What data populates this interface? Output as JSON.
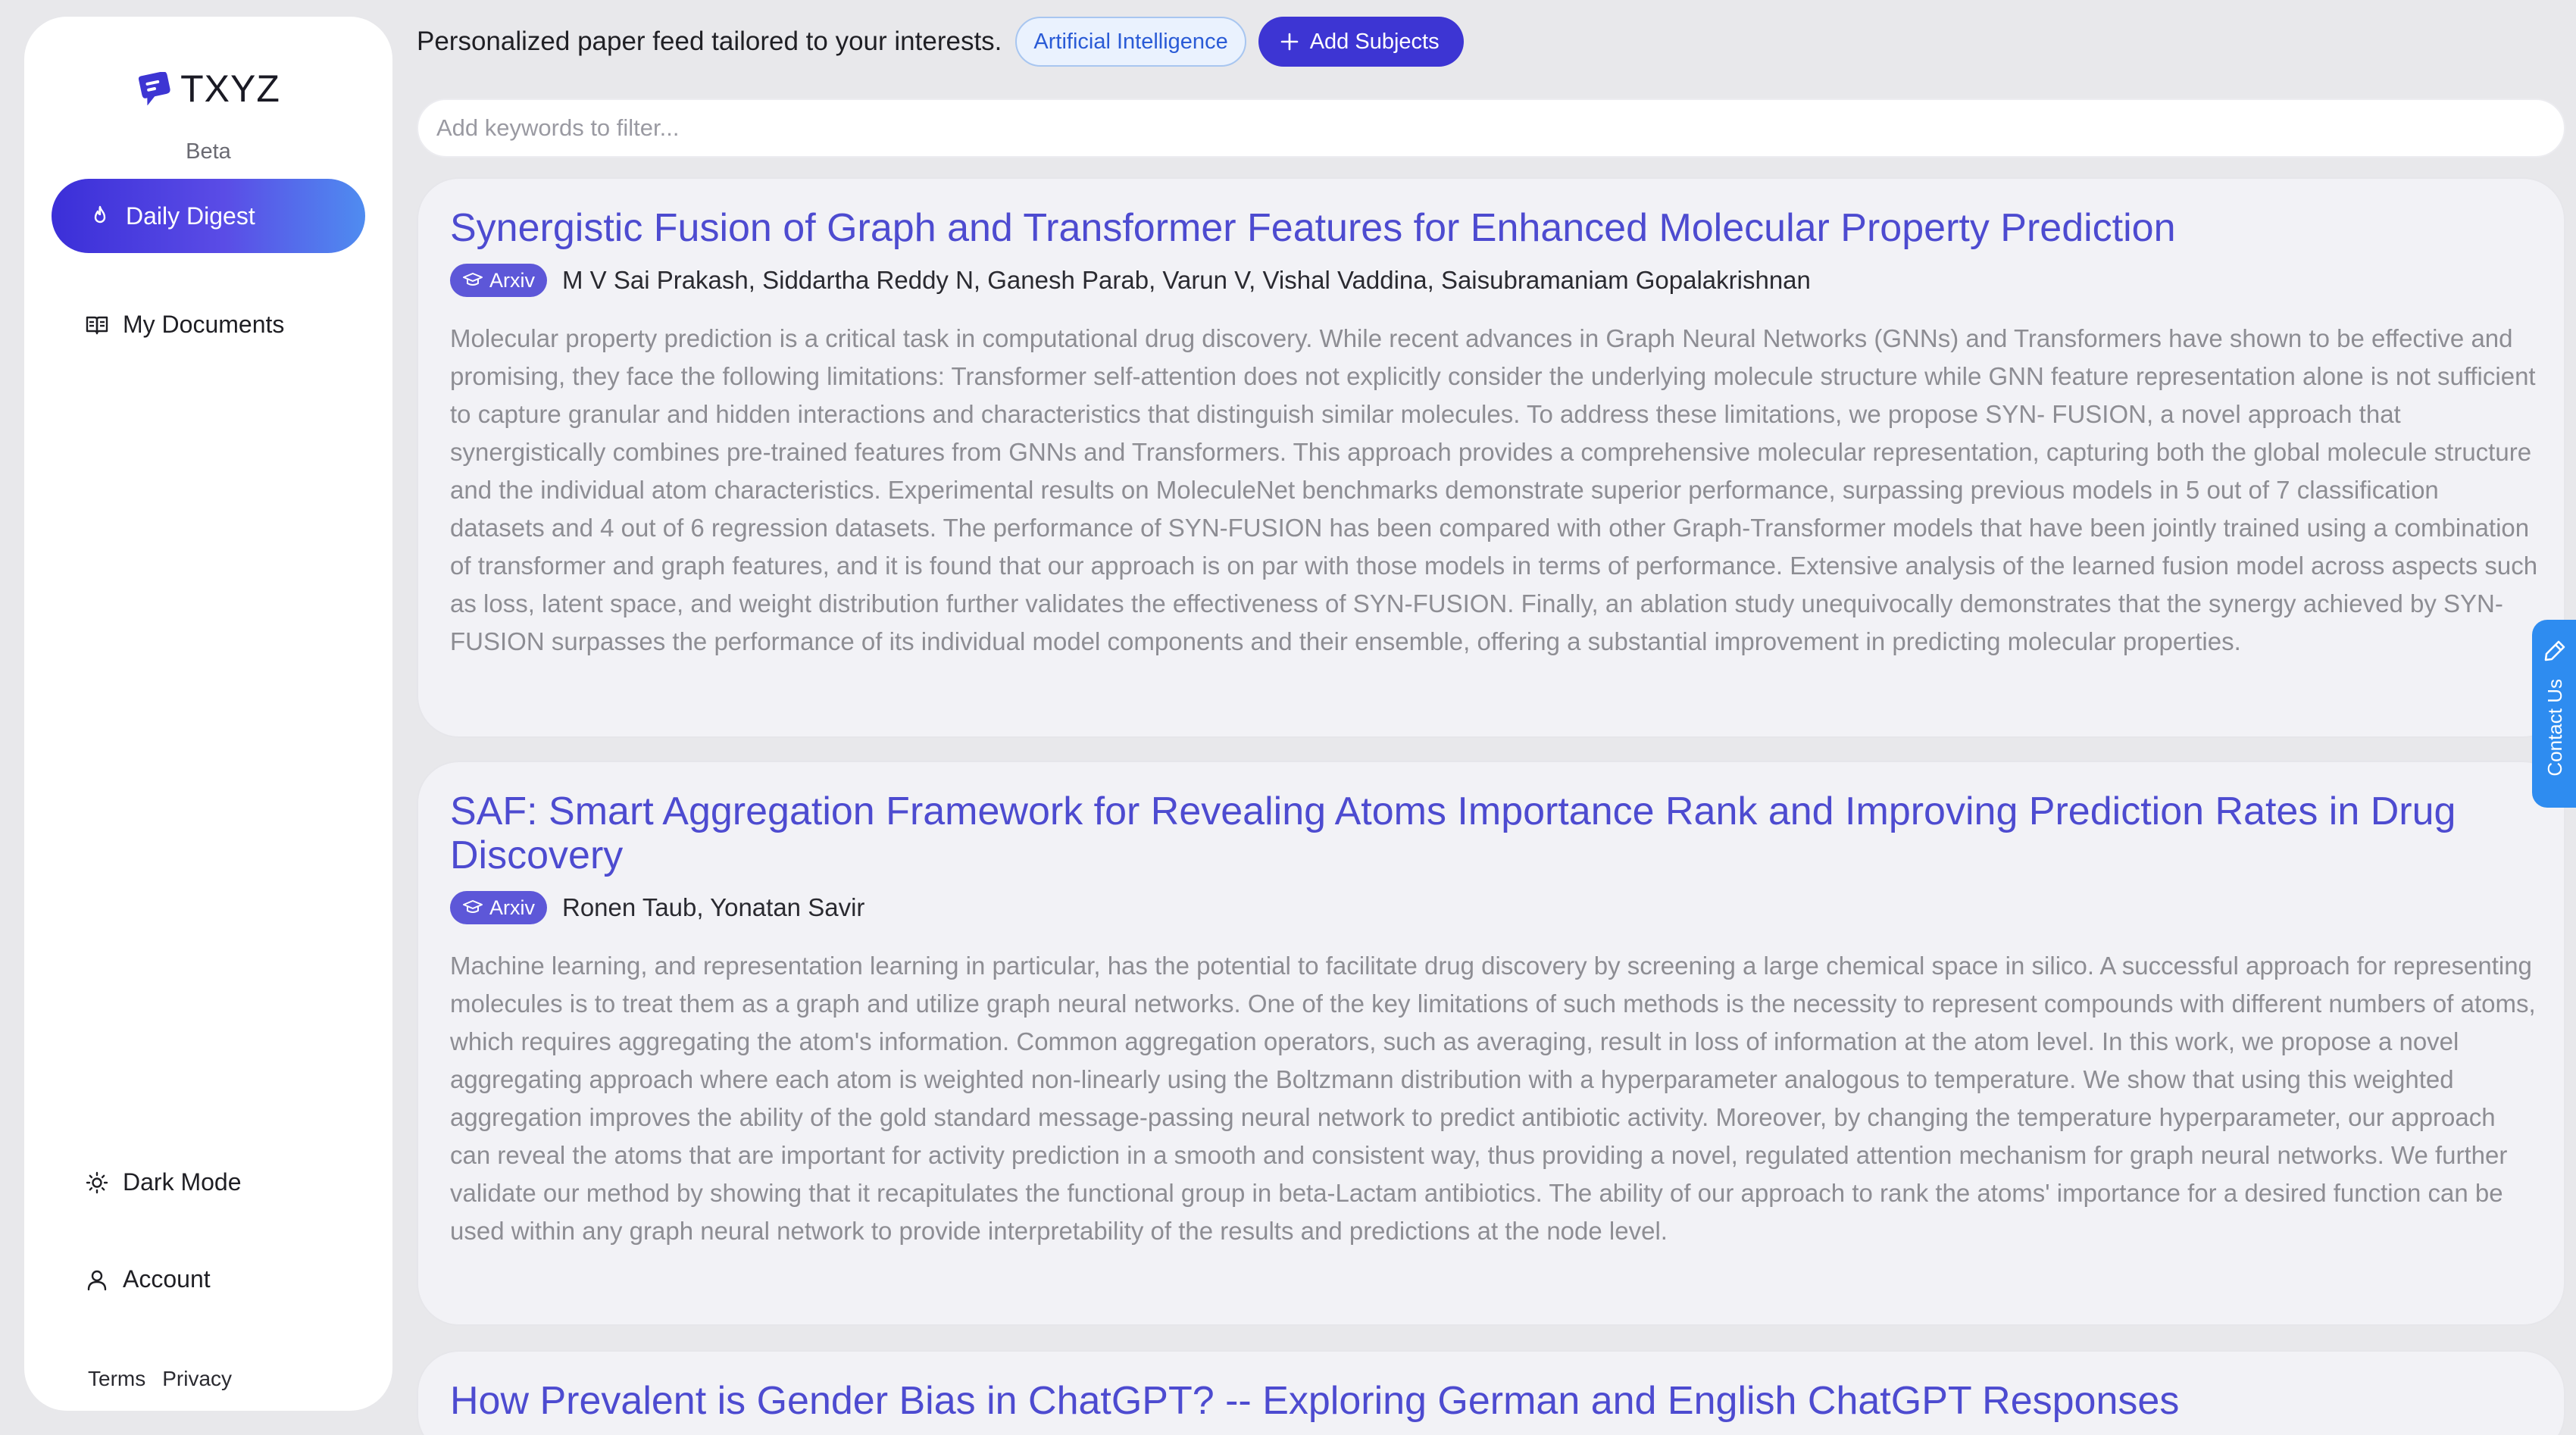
{
  "app": {
    "brand": "TXYZ",
    "badge": "Beta"
  },
  "sidebar": {
    "nav": [
      {
        "label": "Daily Digest",
        "icon": "flame-icon",
        "active": true
      },
      {
        "label": "My Documents",
        "icon": "book-icon",
        "active": false
      }
    ],
    "bottom": [
      {
        "label": "Dark Mode",
        "icon": "sun-icon"
      },
      {
        "label": "Account",
        "icon": "user-icon"
      }
    ],
    "footer": {
      "terms": "Terms",
      "privacy": "Privacy"
    }
  },
  "header": {
    "tagline": "Personalized paper feed tailored to your interests.",
    "subject_chip": "Artificial Intelligence",
    "add_button": "Add Subjects"
  },
  "filter": {
    "placeholder": "Add keywords to filter..."
  },
  "papers": [
    {
      "title": "Synergistic Fusion of Graph and Transformer Features for Enhanced Molecular Property Prediction",
      "source": "Arxiv",
      "authors": "M V Sai Prakash, Siddartha Reddy N, Ganesh Parab, Varun V, Vishal Vaddina, Saisubramaniam Gopalakrishnan",
      "abstract": "Molecular property prediction is a critical task in computational drug discovery. While recent advances in Graph Neural Networks (GNNs) and Transformers have shown to be effective and promising, they face the following limitations: Transformer self-attention does not explicitly consider the underlying molecule structure while GNN feature representation alone is not sufficient to capture granular and hidden interactions and characteristics that distinguish similar molecules. To address these limitations, we propose SYN- FUSION, a novel approach that synergistically combines pre-trained features from GNNs and Transformers. This approach provides a comprehensive molecular representation, capturing both the global molecule structure and the individual atom characteristics. Experimental results on MoleculeNet benchmarks demonstrate superior performance, surpassing previous models in 5 out of 7 classification datasets and 4 out of 6 regression datasets. The performance of SYN-FUSION has been compared with other Graph-Transformer models that have been jointly trained using a combination of transformer and graph features, and it is found that our approach is on par with those models in terms of performance. Extensive analysis of the learned fusion model across aspects such as loss, latent space, and weight distribution further validates the effectiveness of SYN-FUSION. Finally, an ablation study unequivocally demonstrates that the synergy achieved by SYN-FUSION surpasses the performance of its individual model components and their ensemble, offering a substantial improvement in predicting molecular properties."
    },
    {
      "title": "SAF: Smart Aggregation Framework for Revealing Atoms Importance Rank and Improving Prediction Rates in Drug Discovery",
      "source": "Arxiv",
      "authors": "Ronen Taub, Yonatan Savir",
      "abstract": "Machine learning, and representation learning in particular, has the potential to facilitate drug discovery by screening a large chemical space in silico. A successful approach for representing molecules is to treat them as a graph and utilize graph neural networks. One of the key limitations of such methods is the necessity to represent compounds with different numbers of atoms, which requires aggregating the atom's information. Common aggregation operators, such as averaging, result in loss of information at the atom level. In this work, we propose a novel aggregating approach where each atom is weighted non-linearly using the Boltzmann distribution with a hyperparameter analogous to temperature. We show that using this weighted aggregation improves the ability of the gold standard message-passing neural network to predict antibiotic activity. Moreover, by changing the temperature hyperparameter, our approach can reveal the atoms that are important for activity prediction in a smooth and consistent way, thus providing a novel, regulated attention mechanism for graph neural networks. We further validate our method by showing that it recapitulates the functional group in beta-Lactam antibiotics. The ability of our approach to rank the atoms' importance for a desired function can be used within any graph neural network to provide interpretability of the results and predictions at the node level."
    },
    {
      "title": "How Prevalent is Gender Bias in ChatGPT? -- Exploring German and English ChatGPT Responses"
    }
  ],
  "contact": {
    "label": "Contact Us"
  },
  "colors": {
    "accent": "#3d35d3",
    "title_link": "#4d4bd0",
    "contact_tab": "#2e8cf0"
  }
}
